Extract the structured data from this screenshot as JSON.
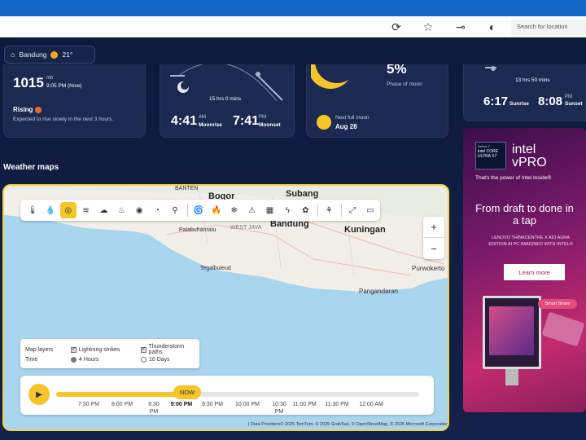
{
  "browser": {
    "search_placeholder": "Search for location"
  },
  "location": {
    "city": "Bandung",
    "temp": "21°"
  },
  "pressure": {
    "value": "1015",
    "unit": "mb",
    "time": "9:05 PM (Now)",
    "status": "Rising",
    "description": "Expected to rise slowly in the next 3 hours."
  },
  "moon": {
    "duration": "15 hrs 0 mins",
    "moonrise_time": "4:41",
    "moonrise_ampm": "AM",
    "moonrise_label": "Moonrise",
    "moonset_time": "7:41",
    "moonset_ampm": "PM",
    "moonset_label": "Moonset"
  },
  "moon_phase": {
    "percent": "5%",
    "label": "Phase of moon",
    "next_label": "Next full moon",
    "next_date": "Aug 28"
  },
  "sun": {
    "duration": "13 hrs 50 mins",
    "sunrise_time": "6:17",
    "sunrise_label": "Sunrise",
    "sunset_time": "8:08",
    "sunset_ampm": "PM",
    "sunset_label": "Sunset"
  },
  "weather_maps": {
    "title": "Weather maps",
    "labels": {
      "bogor": "Bogor",
      "subang": "Subang",
      "banten": "BANTEN",
      "bandung": "Bandung",
      "kuningan": "Kuningan",
      "palabuhanratu": "Palabuhanratu",
      "west_java": "WEST JAVA",
      "tegalbuleud": "Tegalbuleud",
      "pangandaran": "Pangandaran",
      "purwokerto": "Purwokerto"
    },
    "layers": {
      "map_layers_label": "Map layers",
      "lightning": "Lightning strikes",
      "thunderstorm": "Thunderstorm paths",
      "time_label": "Time",
      "hours4": "4 Hours",
      "days10": "10 Days"
    },
    "timeline": {
      "now": "NOW",
      "ticks": [
        "7:30 PM",
        "8:00 PM",
        "8:30 PM",
        "9:00 PM",
        "9:30 PM",
        "10:00 PM",
        "10:30 PM",
        "11:00 PM",
        "11:30 PM",
        "12:00 AM"
      ]
    },
    "attribution": "| Data Providers© 2025 TomTom, © 2025 GrabTaxi, © OpenStreetMap, © 2026 Microsoft Corporation"
  },
  "ad": {
    "series": "Series 2",
    "brand_small": "intel CORE ULTRA X7",
    "brand": "intel",
    "brand_sub": "vPRO",
    "tagline": "That's the power of Intel Inside®",
    "headline": "From draft to done in a tap",
    "body": "LENOVO THINKCENTRE X AIO AURA EDITION AI PC IMAGINED WITH INTEL®",
    "cta": "Learn more",
    "pill": "Smart Share"
  },
  "colors": {
    "accent": "#f5c52a",
    "background": "#0f1b3d"
  }
}
